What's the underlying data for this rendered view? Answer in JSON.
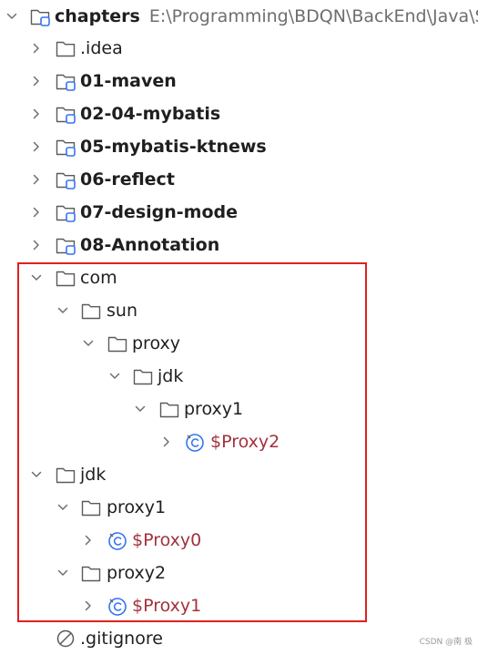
{
  "tree": {
    "root": {
      "name": "chapters",
      "path": "E:\\Programming\\BDQN\\BackEnd\\Java\\SS"
    },
    "items": [
      {
        "name": ".idea"
      },
      {
        "name": "01-maven"
      },
      {
        "name": "02-04-mybatis"
      },
      {
        "name": "05-mybatis-ktnews"
      },
      {
        "name": "06-reflect"
      },
      {
        "name": "07-design-mode"
      },
      {
        "name": "08-Annotation"
      },
      {
        "name": "com"
      },
      {
        "name": "sun"
      },
      {
        "name": "proxy"
      },
      {
        "name": "jdk"
      },
      {
        "name": "proxy1"
      },
      {
        "name": "$Proxy2"
      },
      {
        "name": "jdk"
      },
      {
        "name": "proxy1"
      },
      {
        "name": "$Proxy0"
      },
      {
        "name": "proxy2"
      },
      {
        "name": "$Proxy1"
      },
      {
        "name": ".gitignore"
      }
    ]
  },
  "watermark": "CSDN @南 极",
  "colors": {
    "class_name": "#a2323d",
    "highlight_border": "#e02020",
    "module_badge": "#3574f0"
  },
  "icons": [
    "chevron-down-icon",
    "chevron-right-icon",
    "folder-icon",
    "module-folder-icon",
    "class-icon",
    "ignore-file-icon"
  ]
}
